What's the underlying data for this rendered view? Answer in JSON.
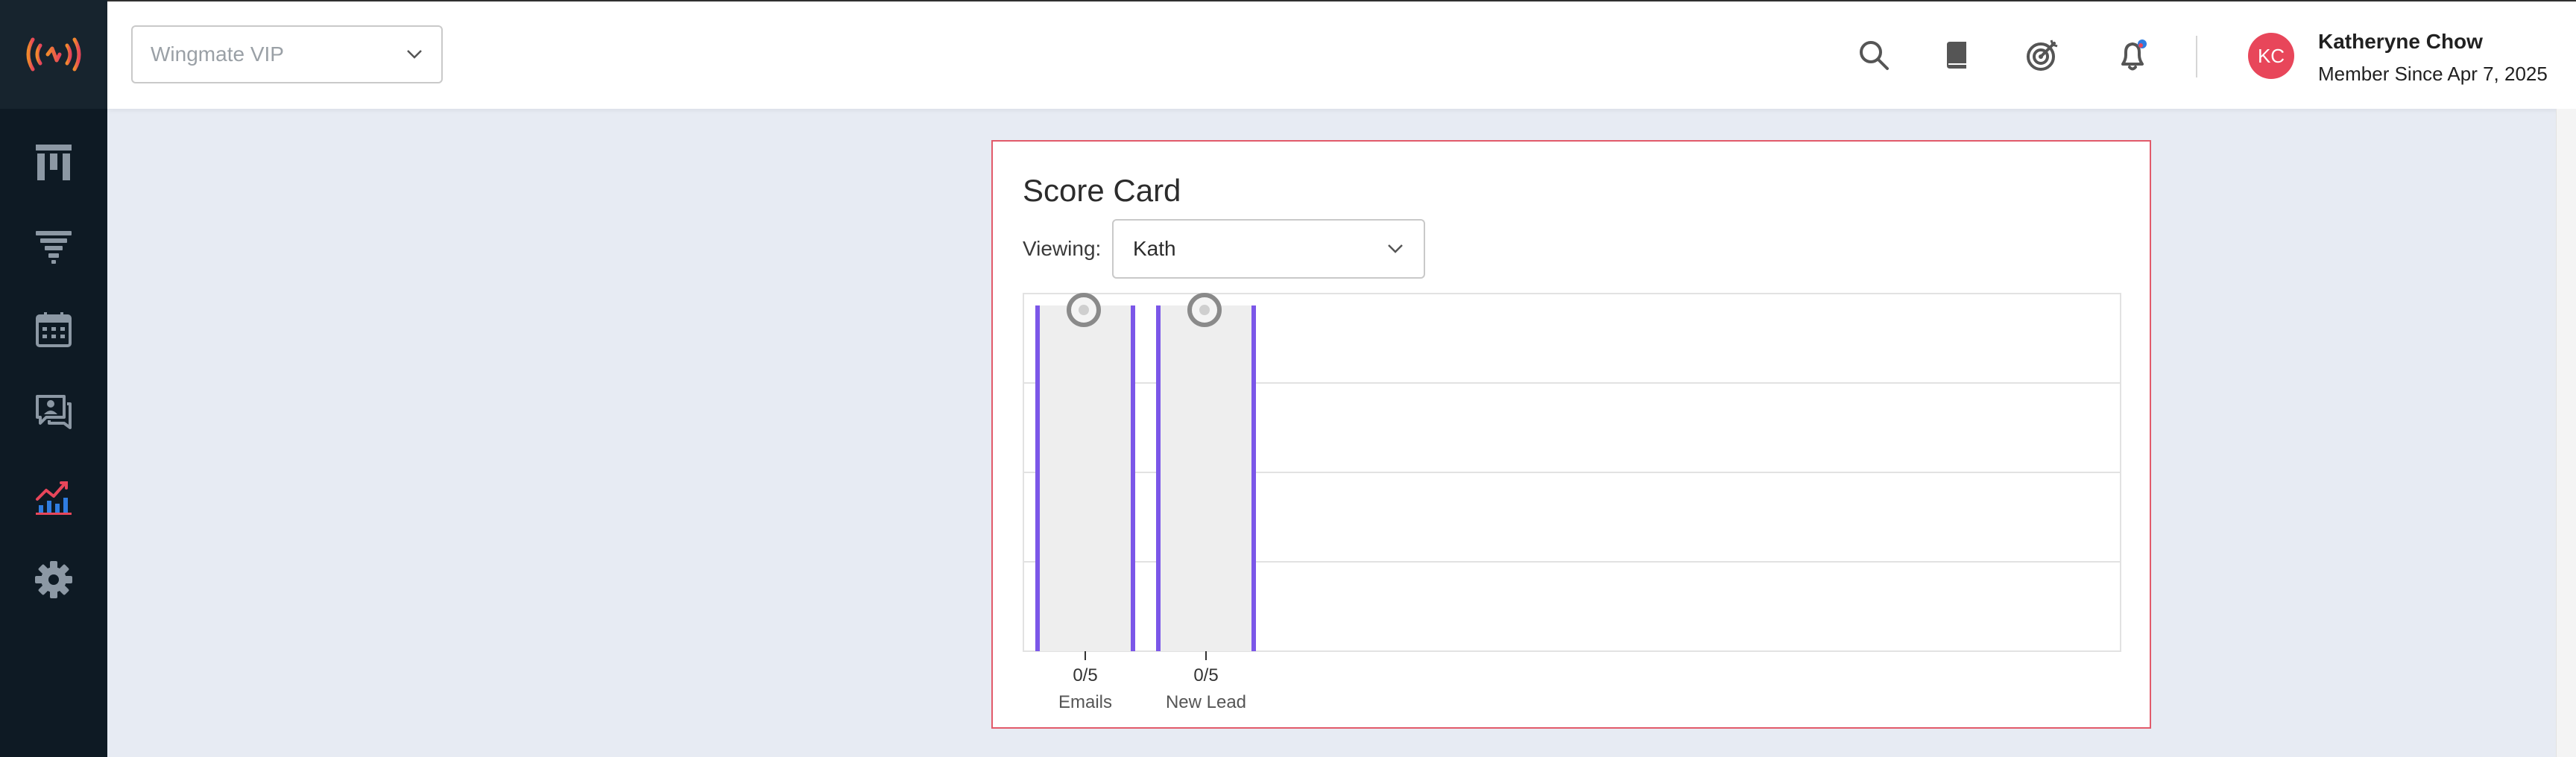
{
  "header": {
    "org_select": {
      "value": "Wingmate VIP"
    },
    "user": {
      "initials": "KC",
      "name": "Katheryne Chow",
      "member_since": "Member Since Apr 7, 2025",
      "avatar_color": "#e8465a"
    },
    "notification_dot_color": "#2f7de1"
  },
  "sidebar": {
    "items": [
      {
        "icon": "board-icon"
      },
      {
        "icon": "funnel-icon"
      },
      {
        "icon": "calendar-icon"
      },
      {
        "icon": "conversation-icon"
      },
      {
        "icon": "analytics-icon",
        "active": true
      },
      {
        "icon": "settings-gear-icon"
      }
    ],
    "accent_color": "#e8465a"
  },
  "score_card": {
    "title": "Score Card",
    "viewing_label": "Viewing:",
    "viewing_value": "Kath"
  },
  "chart_data": {
    "type": "bar",
    "categories": [
      "Emails",
      "New Lead"
    ],
    "values": [
      0,
      0
    ],
    "targets": [
      5,
      5
    ],
    "value_labels": [
      "0/5",
      "0/5"
    ],
    "accent_color": "#7b57e8",
    "grid": true
  }
}
